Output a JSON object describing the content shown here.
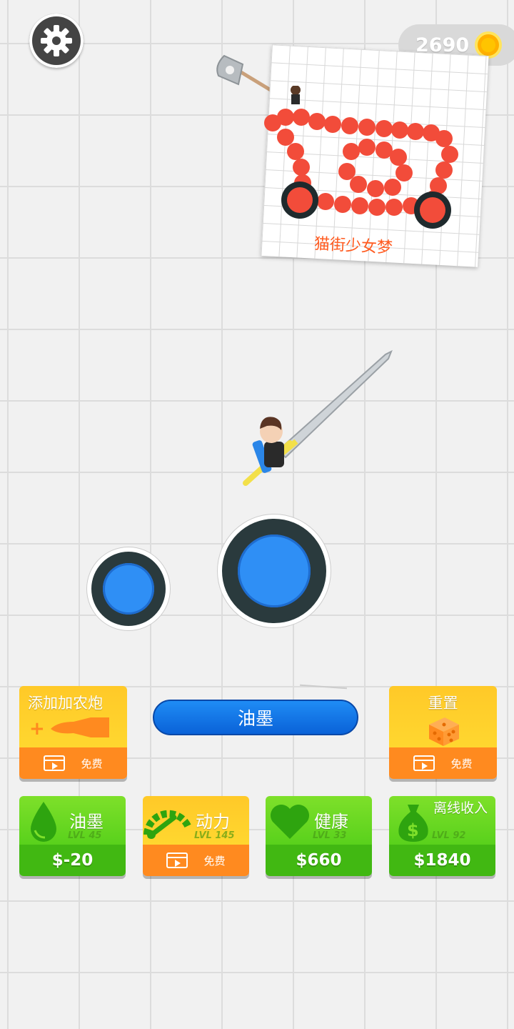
{
  "hud": {
    "coins": "2690",
    "settings_icon": "gear-icon",
    "coin_icon": "coin-icon"
  },
  "drawing_card": {
    "caption": "猫街少女梦"
  },
  "ink_button": {
    "label": "油墨"
  },
  "add_cannon": {
    "label": "添加加农炮",
    "action": "免费",
    "icon": "cannon-icon"
  },
  "reset": {
    "label": "重置",
    "action": "免费",
    "icon": "dice-icon"
  },
  "upgrades": [
    {
      "label": "油墨",
      "level": "LVL 45",
      "price": "$-20",
      "icon": "ink-drop-icon",
      "color": "#47c91a"
    },
    {
      "label": "动力",
      "level": "LVL 145",
      "action": "免费",
      "icon": "speedometer-icon",
      "color": "#ff8a1f"
    },
    {
      "label": "健康",
      "level": "LVL 33",
      "price": "$660",
      "icon": "heart-icon",
      "color": "#47c91a"
    },
    {
      "label": "离线收入",
      "level": "LVL 92",
      "price": "$1840",
      "icon": "money-bag-icon",
      "color": "#47c91a"
    }
  ],
  "colors": {
    "orange": "#ff8a1f",
    "yellow": "#ffd21e",
    "green": "#47c91a",
    "blue": "#1478ea",
    "bead": "#f24c3a"
  }
}
